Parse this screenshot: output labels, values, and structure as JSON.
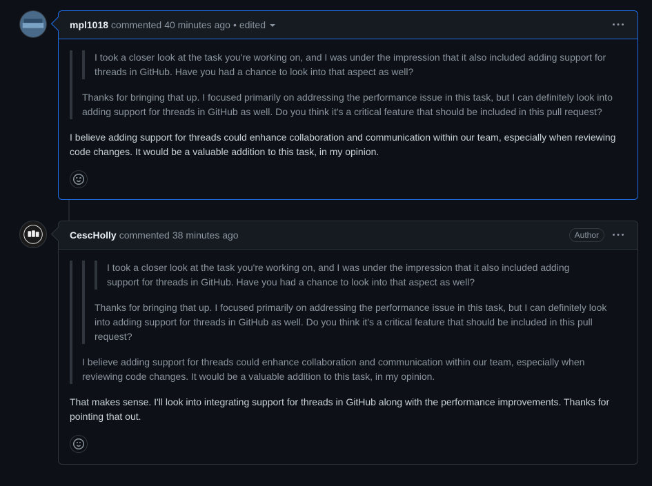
{
  "comments": [
    {
      "author": "mpl1018",
      "commented_label": "commented",
      "timestamp": "40 minutes ago",
      "separator": "•",
      "edited_label": "edited",
      "highlight": true,
      "badges": [],
      "body": {
        "quote_outer": {
          "quote_inner": "I took a closer look at the task you're working on, and I was under the impression that it also included adding support for threads in GitHub. Have you had a chance to look into that aspect as well?",
          "reply": "Thanks for bringing that up. I focused primarily on addressing the performance issue in this task, but I can definitely look into adding support for threads in GitHub as well. Do you think it's a critical feature that should be included in this pull request?"
        },
        "text": "I believe adding support for threads could enhance collaboration and communication within our team, especially when reviewing code changes. It would be a valuable addition to this task, in my opinion."
      }
    },
    {
      "author": "CescHolly",
      "commented_label": "commented",
      "timestamp": "38 minutes ago",
      "highlight": false,
      "badges": [
        "Author"
      ],
      "body": {
        "quote_outer": {
          "quote_mid": {
            "quote_inner": "I took a closer look at the task you're working on, and I was under the impression that it also included adding support for threads in GitHub. Have you had a chance to look into that aspect as well?",
            "reply": "Thanks for bringing that up. I focused primarily on addressing the performance issue in this task, but I can definitely look into adding support for threads in GitHub as well. Do you think it's a critical feature that should be included in this pull request?"
          },
          "reply": "I believe adding support for threads could enhance collaboration and communication within our team, especially when reviewing code changes. It would be a valuable addition to this task, in my opinion."
        },
        "text": "That makes sense. I'll look into integrating support for threads in GitHub along with the performance improvements. Thanks for pointing that out."
      }
    }
  ]
}
